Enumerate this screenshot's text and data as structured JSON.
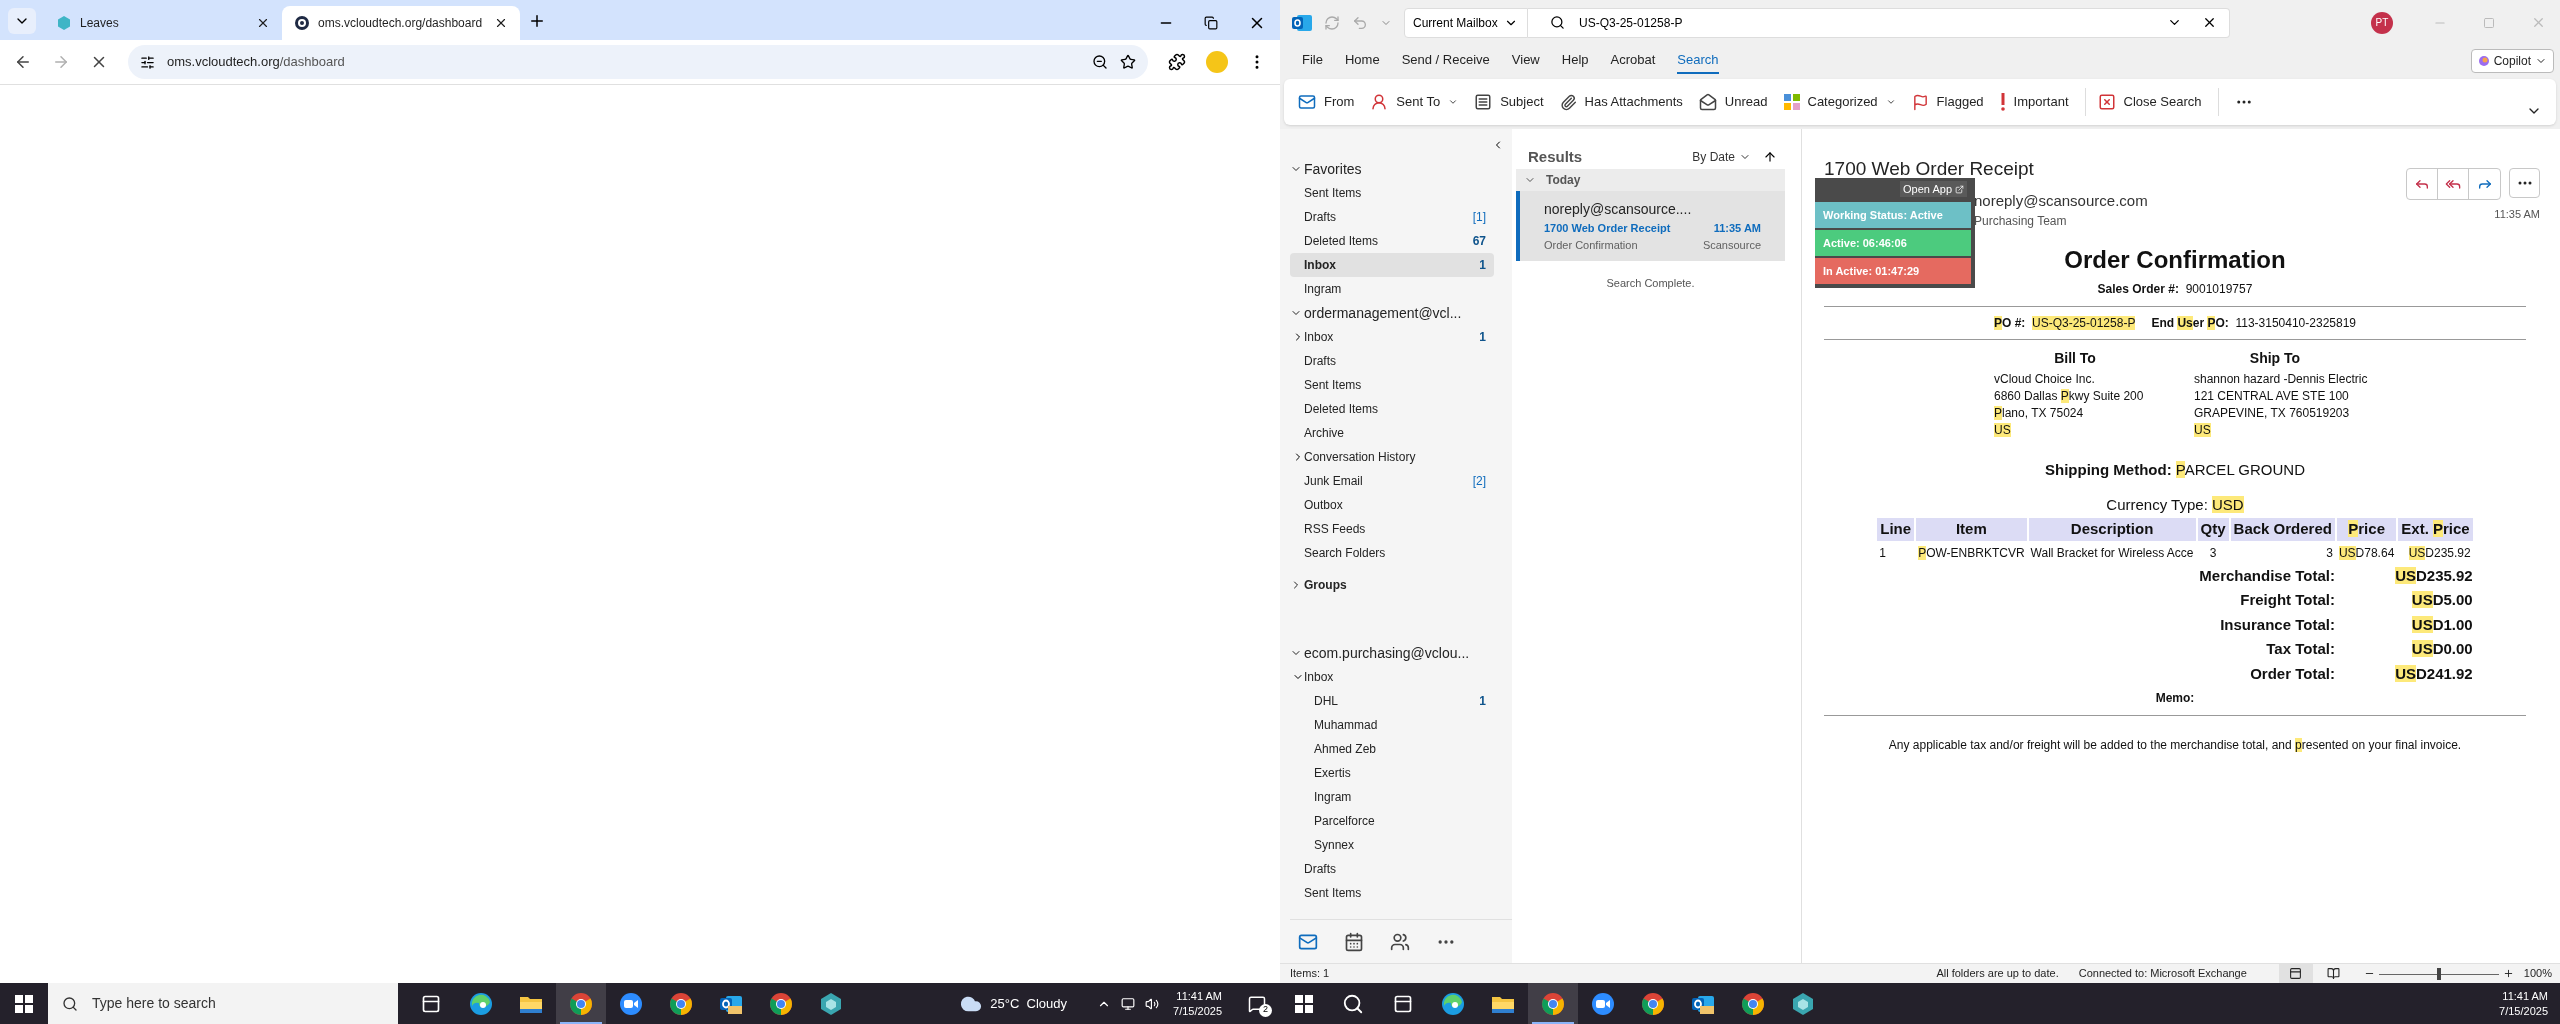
{
  "browser": {
    "tabs": [
      {
        "title": "Leaves",
        "selected": false
      },
      {
        "title": "oms.vcloudtech.org/dashboard",
        "selected": true
      }
    ],
    "address": {
      "host": "oms.vcloudtech.org",
      "path": "/dashboard"
    }
  },
  "outlook": {
    "scope": "Current Mailbox",
    "search_value": "US-Q3-25-01258-P",
    "profile_initials": "PT",
    "menu": [
      {
        "label": "File",
        "selected": false
      },
      {
        "label": "Home",
        "selected": false
      },
      {
        "label": "Send / Receive",
        "selected": false
      },
      {
        "label": "View",
        "selected": false
      },
      {
        "label": "Help",
        "selected": false
      },
      {
        "label": "Acrobat",
        "selected": false
      },
      {
        "label": "Search",
        "selected": true
      }
    ],
    "copilot": "Copilot",
    "ribbon": [
      {
        "kind": "from",
        "label": "From",
        "dropdown": false
      },
      {
        "kind": "sent_to",
        "label": "Sent To",
        "dropdown": true
      },
      {
        "kind": "subject",
        "label": "Subject",
        "dropdown": false
      },
      {
        "kind": "attachments",
        "label": "Has Attachments",
        "dropdown": false
      },
      {
        "kind": "unread",
        "label": "Unread",
        "dropdown": false
      },
      {
        "kind": "categorized",
        "label": "Categorized",
        "dropdown": true
      },
      {
        "kind": "flagged",
        "label": "Flagged",
        "dropdown": false
      },
      {
        "kind": "important",
        "label": "Important",
        "dropdown": false
      },
      {
        "kind": "close",
        "label": "Close Search",
        "dropdown": false
      }
    ],
    "folders": [
      {
        "title": "Favorites",
        "expanded": true,
        "items": [
          {
            "name": "Sent Items",
            "selected": false
          },
          {
            "name": "Drafts",
            "count": "[1]",
            "unread": false,
            "selected": false
          },
          {
            "name": "Deleted Items",
            "count": "67",
            "unread": true,
            "selected": false
          },
          {
            "name": "Inbox",
            "count": "1",
            "unread": true,
            "selected": true
          },
          {
            "name": "Ingram",
            "selected": false
          }
        ]
      },
      {
        "title": "ordermanagement@vcl...",
        "expanded": true,
        "items": [
          {
            "name": "Inbox",
            "count": "1",
            "unread": true,
            "selected": false,
            "expanded": false
          },
          {
            "name": "Drafts",
            "selected": false
          },
          {
            "name": "Sent Items",
            "selected": false
          },
          {
            "name": "Deleted Items",
            "selected": false
          },
          {
            "name": "Archive",
            "selected": false
          },
          {
            "name": "Conversation History",
            "selected": false,
            "expanded": false
          },
          {
            "name": "Junk Email",
            "count": "[2]",
            "unread": false,
            "selected": false
          },
          {
            "name": "Outbox",
            "selected": false
          },
          {
            "name": "RSS Feeds",
            "selected": false
          },
          {
            "name": "Search Folders",
            "selected": false
          }
        ]
      },
      {
        "title": "Groups",
        "expanded": false
      },
      {
        "title": "ecom.purchasing@vclou...",
        "expanded": true,
        "items": [
          {
            "name": "Inbox",
            "selected": false,
            "expanded": true,
            "children": [
              {
                "name": "DHL",
                "count": "1",
                "unread": true,
                "selected": false
              },
              {
                "name": "Muhammad",
                "selected": false
              },
              {
                "name": "Ahmed Zeb",
                "selected": false
              },
              {
                "name": "Exertis",
                "selected": false
              },
              {
                "name": "Ingram",
                "selected": false
              },
              {
                "name": "Parcelforce",
                "selected": false
              },
              {
                "name": "Synnex",
                "selected": false
              }
            ]
          },
          {
            "name": "Drafts",
            "selected": false
          },
          {
            "name": "Sent Items",
            "selected": false
          }
        ]
      }
    ],
    "results": {
      "title": "Results",
      "sort": "By Date",
      "group": "Today",
      "messages": [
        {
          "from": "noreply@scansource....",
          "subject": "1700 Web Order Receipt",
          "time": "11:35 AM",
          "preview": "Order Confirmation",
          "tag": "Scansource",
          "selected": true
        }
      ],
      "footer": "Search Complete."
    },
    "message": {
      "subject": "1700 Web Order Receipt",
      "sender": "noreply@scansource.com",
      "recipient": "Purchasing Team",
      "time": "11:35 AM",
      "body": {
        "heading": "Order Confirmation",
        "sales_order": {
          "label": "Sales Order #:",
          "value": "9001019757"
        },
        "po": {
          "label": [
            {
              "text": "P",
              "highlighted": true
            },
            {
              "text": "O #:",
              "highlighted": false
            }
          ],
          "value": [
            {
              "text": "US-Q3-25-01258-P",
              "highlighted": true
            }
          ]
        },
        "end_user_po": {
          "label": [
            {
              "text": "End ",
              "highlighted": false
            },
            {
              "text": "Us",
              "highlighted": true
            },
            {
              "text": "er ",
              "highlighted": false
            },
            {
              "text": "P",
              "highlighted": true
            },
            {
              "text": "O:",
              "highlighted": false
            }
          ],
          "value": "113-3150410-2325819"
        },
        "bill_to": {
          "title": "Bill To",
          "lines": [
            "vCloud Choice Inc.",
            [
              {
                "text": "6860 Dallas ",
                "highlighted": false
              },
              {
                "text": "P",
                "highlighted": true
              },
              {
                "text": "kwy Suite 200",
                "highlighted": false
              }
            ],
            [
              {
                "text": "P",
                "highlighted": true
              },
              {
                "text": "lano, TX 75024",
                "highlighted": false
              }
            ],
            [
              {
                "text": "US",
                "highlighted": true
              }
            ]
          ]
        },
        "ship_to": {
          "title": "Ship To",
          "lines": [
            "shannon hazard -Dennis Electric",
            "121 CENTRAL AVE STE 100",
            "GRAPEVINE, TX 760519203",
            [
              {
                "text": "US",
                "highlighted": true
              }
            ]
          ]
        },
        "shipping": {
          "label": "Shipping Method:",
          "value": [
            {
              "text": "P",
              "highlighted": true
            },
            {
              "text": "ARCEL GROUND",
              "highlighted": false
            }
          ]
        },
        "currency": {
          "label": "Currency Type:",
          "value": [
            {
              "text": "USD",
              "highlighted": true
            }
          ]
        },
        "table": {
          "columns": [
            "Line",
            "Item",
            "Description",
            "Qty",
            "Back Ordered",
            [
              {
                "text": "P",
                "highlighted": true
              },
              {
                "text": "rice",
                "highlighted": false
              }
            ],
            [
              {
                "text": "Ext. ",
                "highlighted": false
              },
              {
                "text": "P",
                "highlighted": true
              },
              {
                "text": "rice",
                "highlighted": false
              }
            ]
          ],
          "rows": [
            [
              "1",
              [
                {
                  "text": "P",
                  "highlighted": true
                },
                {
                  "text": "OW-ENBRKTCVR",
                  "highlighted": false
                }
              ],
              "Wall Bracket for Wireless Acce",
              "3",
              "3",
              [
                {
                  "text": "US",
                  "highlighted": true
                },
                {
                  "text": "D78.64",
                  "highlighted": false
                }
              ],
              [
                {
                  "text": "US",
                  "highlighted": true
                },
                {
                  "text": "D235.92",
                  "highlighted": false
                }
              ]
            ]
          ]
        },
        "totals": [
          {
            "label": "Merchandise Total:",
            "value": [
              {
                "text": "US",
                "highlighted": true
              },
              {
                "text": "D235.92",
                "highlighted": false
              }
            ]
          },
          {
            "label": "Freight Total:",
            "value": [
              {
                "text": "US",
                "highlighted": true
              },
              {
                "text": "D5.00",
                "highlighted": false
              }
            ]
          },
          {
            "label": "Insurance Total:",
            "value": [
              {
                "text": "US",
                "highlighted": true
              },
              {
                "text": "D1.00",
                "highlighted": false
              }
            ]
          },
          {
            "label": "Tax Total:",
            "value": [
              {
                "text": "US",
                "highlighted": true
              },
              {
                "text": "D0.00",
                "highlighted": false
              }
            ]
          },
          {
            "label": "Order Total:",
            "value": [
              {
                "text": "US",
                "highlighted": true
              },
              {
                "text": "D241.92",
                "highlighted": false
              }
            ]
          }
        ],
        "memo": "Memo:",
        "note": [
          {
            "text": "Any applicable tax and/or freight will be added to the merchandise total, and ",
            "highlighted": false
          },
          {
            "text": "p",
            "highlighted": true
          },
          {
            "text": "resented on your final invoice.",
            "highlighted": false
          }
        ]
      }
    },
    "status_bar": {
      "items": "Items: 1",
      "sync": "All folders are up to date.",
      "connection": "Connected to: Microsoft Exchange",
      "zoom": "100%",
      "zoom_slider": {
        "level": 0.5
      }
    }
  },
  "widget": {
    "open_app": "Open App",
    "rows": [
      {
        "text": "Working Status: Active",
        "color": "#6dc0c6"
      },
      {
        "text": "Active: 06:46:06",
        "color": "#4ccb7e"
      },
      {
        "text": "In Active: 01:47:29",
        "color": "#e56a60"
      }
    ]
  },
  "taskbar_left": {
    "search_placeholder": "Type here to search",
    "apps": [
      {
        "kind": "taskview",
        "selected": false
      },
      {
        "kind": "edge",
        "selected": false
      },
      {
        "kind": "explorer",
        "selected": false
      },
      {
        "kind": "chrome",
        "selected": true
      },
      {
        "kind": "zoom",
        "selected": false
      },
      {
        "kind": "chrome",
        "selected": false
      },
      {
        "kind": "outlook",
        "selected": false
      },
      {
        "kind": "chrome",
        "selected": false
      },
      {
        "kind": "cube",
        "selected": false
      }
    ],
    "weather": "25°C  Cloudy",
    "time": "11:41 AM",
    "date": "7/15/2025",
    "notifications": "2"
  },
  "taskbar_right": {
    "apps": [
      {
        "kind": "search",
        "selected": false
      },
      {
        "kind": "taskview",
        "selected": false
      },
      {
        "kind": "edge",
        "selected": false
      },
      {
        "kind": "explorer",
        "selected": false
      },
      {
        "kind": "chrome",
        "selected": true
      },
      {
        "kind": "zoom",
        "selected": false
      },
      {
        "kind": "chrome",
        "selected": false
      },
      {
        "kind": "outlook",
        "selected": false
      },
      {
        "kind": "chrome",
        "selected": false
      },
      {
        "kind": "cube",
        "selected": false
      }
    ],
    "time": "11:41 AM",
    "date": "7/15/2025"
  }
}
